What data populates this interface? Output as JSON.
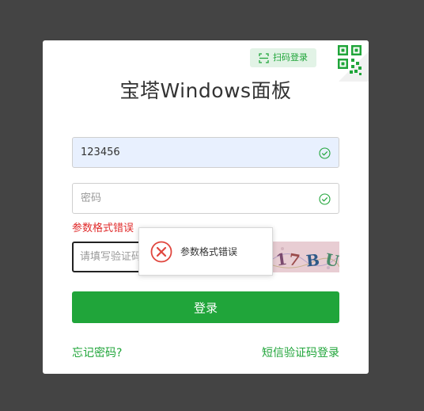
{
  "panel": {
    "title": "宝塔Windows面板",
    "qr_tag_label": "扫码登录"
  },
  "form": {
    "username_value": "123456",
    "password_placeholder": "密码",
    "error_text": "参数格式错误",
    "captcha_placeholder": "请填写验证码",
    "captcha_chars": [
      "1",
      "7",
      "B",
      "U"
    ],
    "login_label": "登录"
  },
  "links": {
    "forgot_password": "忘记密码?",
    "sms_login": "短信验证码登录"
  },
  "toast": {
    "message": "参数格式错误"
  },
  "colors": {
    "brand_green": "#20a53a",
    "error_red": "#e02b2b",
    "backdrop": "#444444"
  },
  "icons": {
    "qr_corner": "qr-code-icon",
    "qr_tag": "scan-icon",
    "field_check": "check-circle-icon",
    "toast": "error-circle-icon"
  }
}
